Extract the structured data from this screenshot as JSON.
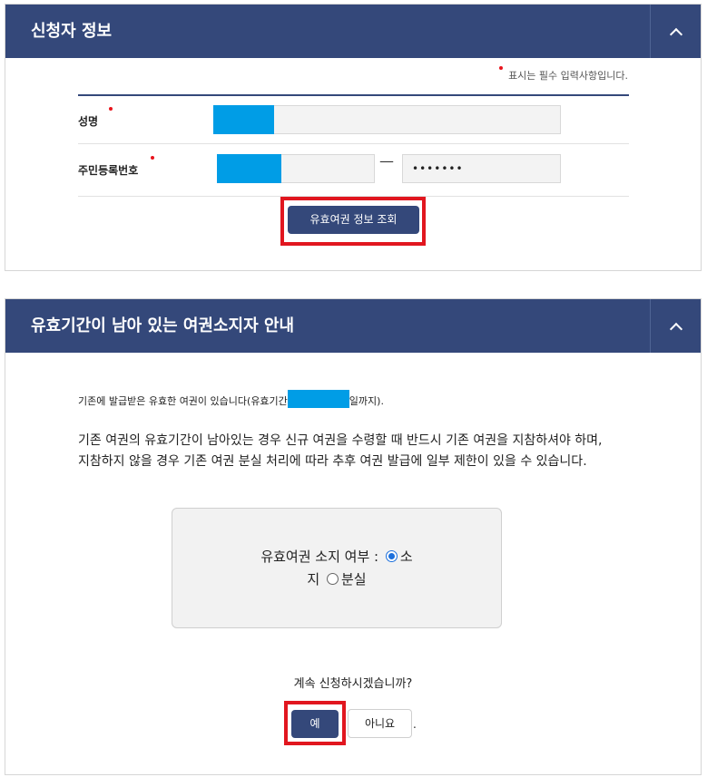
{
  "applicant": {
    "title": "신청자 정보",
    "required_note": "표시는 필수 입력사항입니다.",
    "fields": {
      "name_label": "성명",
      "rrn_label": "주민등록번호",
      "rrn_separator": "—",
      "rrn_back_value": "•••••••"
    },
    "lookup_button": "유효여권 정보 조회"
  },
  "valid_passport": {
    "title": "유효기간이 남아 있는 여권소지자 안내",
    "notice_prefix": "기존에 발급받은 유효한 여권이 있습니다(유효기간",
    "notice_suffix": "일까지).",
    "warning_line1": "기존 여권의 유효기간이 남아있는 경우 신규 여권을 수령할 때 반드시 기존 여권을 지참하셔야 하며,",
    "warning_line2": "지참하지 않을 경우 기존 여권 분실 처리에 따라 추후 여권 발급에 일부 제한이 있을 수 있습니다.",
    "possession_question": "유효여권 소지 여부 :",
    "option_possess_part1": "소",
    "option_possess_part2": "지",
    "option_lost": "분실",
    "selected_option": "소지",
    "continue_question": "계속 신청하시겠습니까?",
    "yes_button": "예",
    "no_button": "아니요",
    "trailing_dot": "."
  },
  "colors": {
    "header_bg": "#34487a",
    "required_dot": "#e8141c",
    "highlight_border": "#e1161f",
    "redaction": "#009de6"
  },
  "icons": {
    "collapse": "chevron-up-icon",
    "radio_selected": "radio-checked-icon",
    "radio_unselected": "radio-unchecked-icon"
  }
}
